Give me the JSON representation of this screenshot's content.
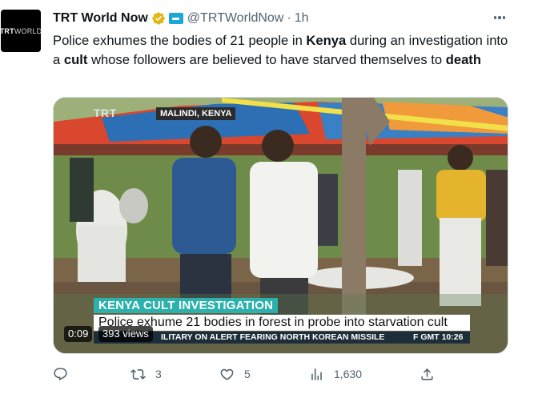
{
  "author": {
    "display_name": "TRT World Now",
    "handle": "@TRTWorldNow",
    "separator": "·",
    "time": "1h",
    "avatar_text_main": "TRT",
    "avatar_text_accent": "WORLD"
  },
  "tweet": {
    "parts": [
      {
        "text": "Police exhumes the bodies of 21 people in ",
        "bold": false
      },
      {
        "text": "Kenya",
        "bold": true
      },
      {
        "text": " during an investigation into a ",
        "bold": false
      },
      {
        "text": "cult",
        "bold": true
      },
      {
        "text": " whose followers are believed to have starved themselves to ",
        "bold": false
      },
      {
        "text": "death",
        "bold": true
      }
    ]
  },
  "video": {
    "logo": "TRT",
    "location": "MALINDI, KENYA",
    "lower_third_tag": "KENYA CULT INVESTIGATION",
    "lower_third_headline": "Police exhume 21 bodies in forest in probe into starvation cult",
    "ticker": "ILITARY ON ALERT FEARING NORTH KOREAN MISSILE",
    "ticker_clock": "F  GMT 10:26",
    "duration": "0:09",
    "views": "393 views"
  },
  "actions": {
    "reply_count": "",
    "retweet_count": "3",
    "like_count": "5",
    "views_count": "1,630"
  },
  "colors": {
    "verified_gold": "#e2b719",
    "affiliate_blue": "#1da6d8",
    "muted_text": "#536471",
    "lower_third_teal": "#2db1ad"
  }
}
